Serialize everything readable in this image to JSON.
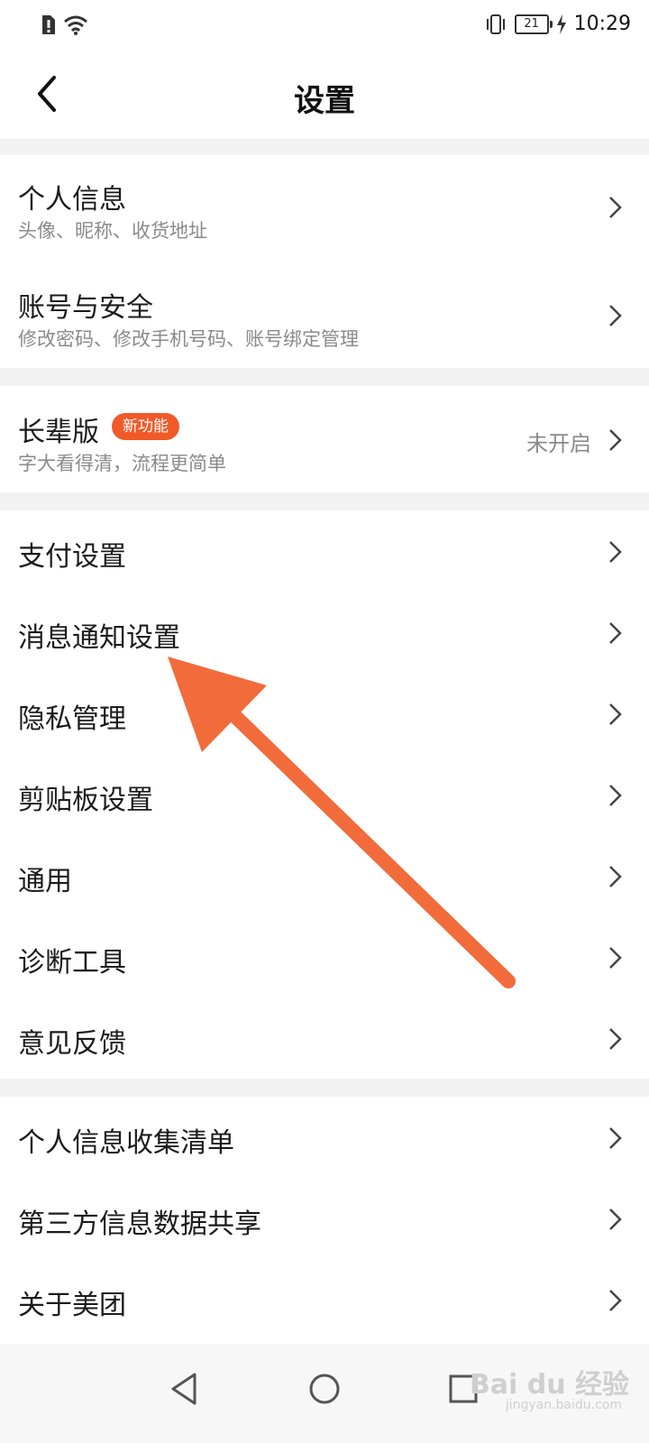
{
  "status_bar": {
    "battery": "21",
    "time": "10:29",
    "icons": [
      "sim-alert-icon",
      "wifi-icon",
      "vibrate-icon",
      "battery-icon",
      "charging-icon"
    ]
  },
  "header": {
    "title": "设置",
    "back_icon": "chevron-left-icon"
  },
  "sections": [
    {
      "items": [
        {
          "title": "个人信息",
          "subtitle": "头像、昵称、收货地址"
        },
        {
          "title": "账号与安全",
          "subtitle": "修改密码、修改手机号码、账号绑定管理"
        }
      ]
    },
    {
      "items": [
        {
          "title": "长辈版",
          "badge": "新功能",
          "subtitle": "字大看得清，流程更简单",
          "status": "未开启"
        }
      ]
    },
    {
      "items": [
        {
          "title": "支付设置"
        },
        {
          "title": "消息通知设置"
        },
        {
          "title": "隐私管理"
        },
        {
          "title": "剪贴板设置"
        },
        {
          "title": "通用"
        },
        {
          "title": "诊断工具"
        },
        {
          "title": "意见反馈"
        }
      ]
    },
    {
      "items": [
        {
          "title": "个人信息收集清单"
        },
        {
          "title": "第三方信息数据共享"
        },
        {
          "title": "关于美团"
        }
      ]
    }
  ],
  "nav_bar": {
    "buttons": [
      "back-triangle-icon",
      "home-circle-icon",
      "recents-square-icon"
    ]
  },
  "watermark": {
    "logo": "Bai du 经验",
    "url": "jingyan.baidu.com"
  },
  "colors": {
    "accent": "#f05a28",
    "annotation_arrow": "#f26b3a",
    "background": "#f2f2f2"
  }
}
